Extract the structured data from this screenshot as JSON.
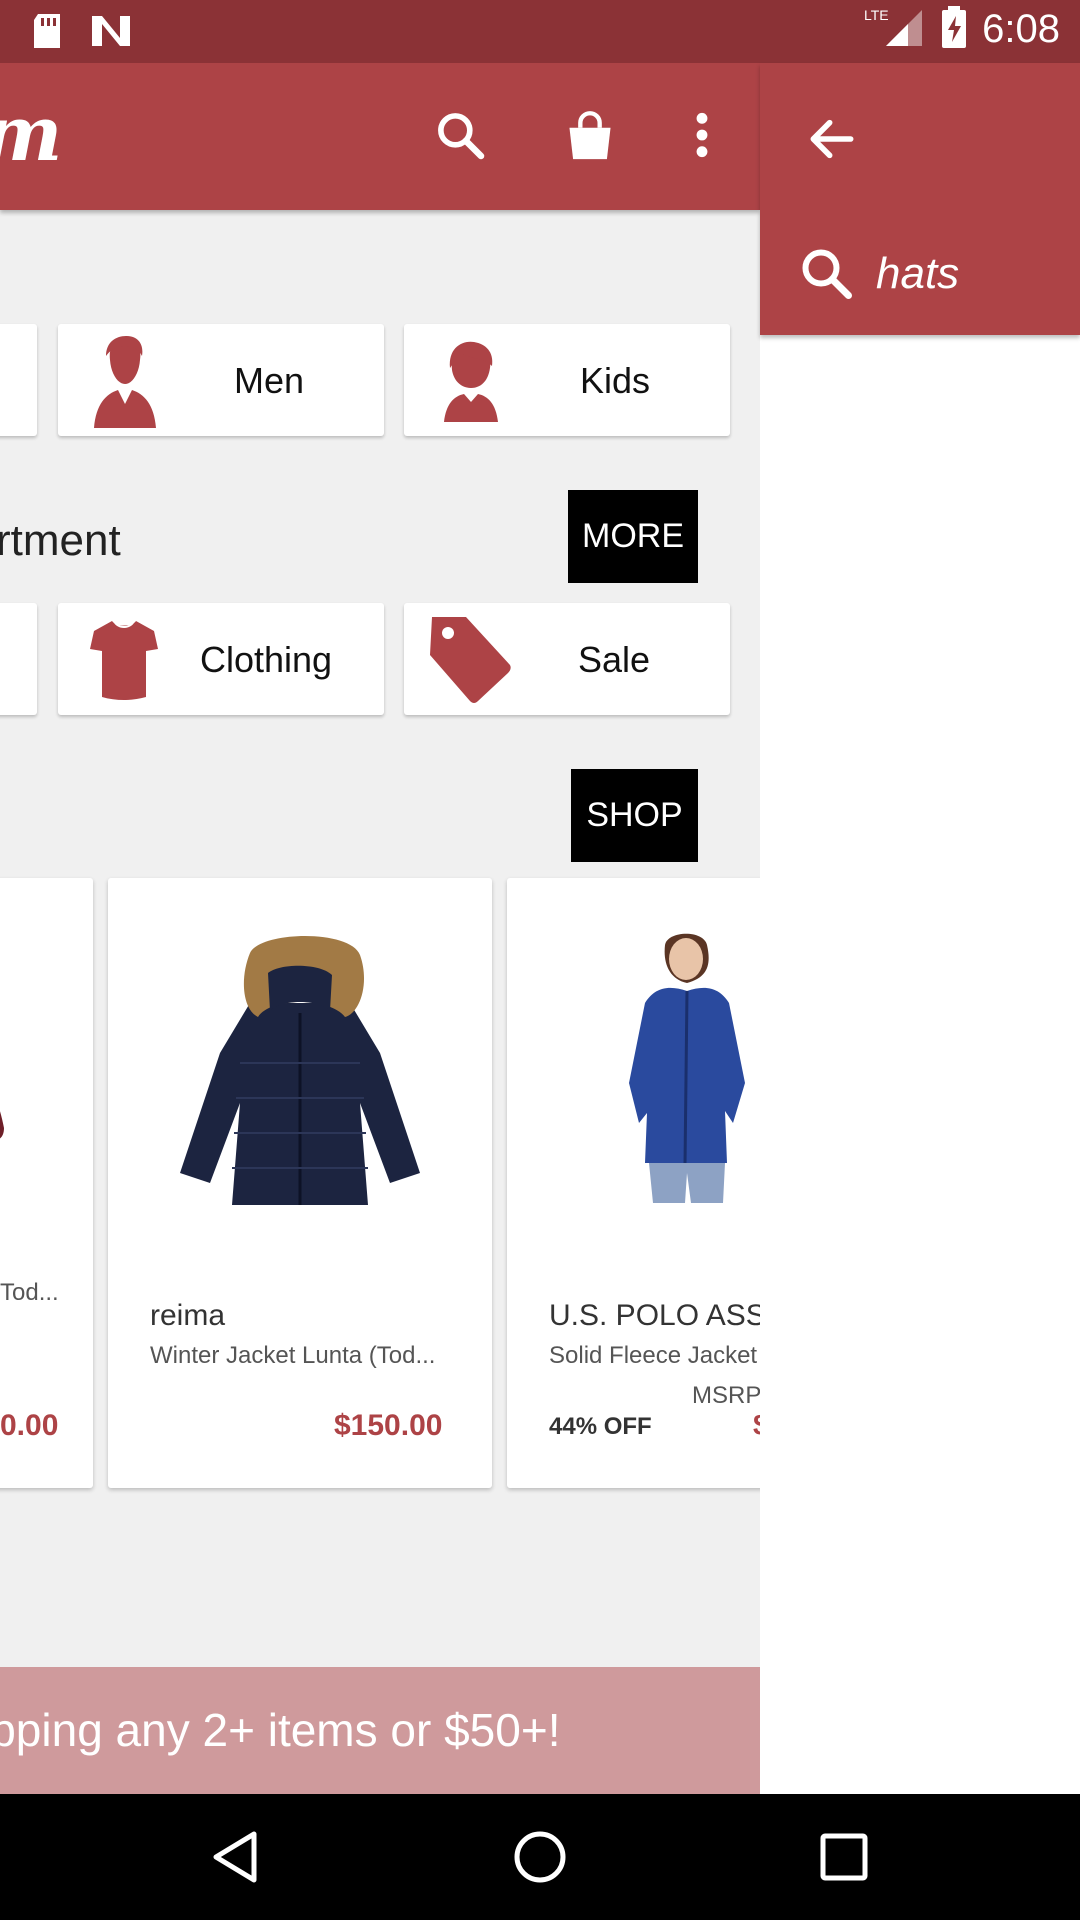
{
  "status_bar": {
    "time": "6:08",
    "network": "LTE",
    "icons": [
      "sd-card-icon",
      "n-notification-icon",
      "lte-signal-icon",
      "battery-charging-icon"
    ]
  },
  "toolbar": {
    "logo_text": "m",
    "icons": [
      "search-icon",
      "shopping-bag-icon",
      "overflow-menu-icon"
    ],
    "background": "#ad4346"
  },
  "categories_row1": [
    {
      "label": "Men",
      "icon": "man-icon"
    },
    {
      "label": "Kids",
      "icon": "kid-icon"
    }
  ],
  "department": {
    "title_partial": "rtment",
    "more_label": "MORE"
  },
  "categories_row2": [
    {
      "label": "Clothing",
      "icon": "shirt-icon"
    },
    {
      "label": "Sale",
      "icon": "tag-icon"
    }
  ],
  "shop_label": "SHOP",
  "products": [
    {
      "name_partial": "Tod...",
      "price_partial": "0.00"
    },
    {
      "brand": "reima",
      "name": "Winter Jacket Lunta (Tod...",
      "price": "$150.00"
    },
    {
      "brand": "U.S. POLO ASS",
      "name": "Solid Fleece Jacket",
      "msrp_label": "MSRP",
      "discount": "44% OFF",
      "price_partial": "$"
    }
  ],
  "banner": {
    "text": "ipping any 2+ items or $50+!",
    "color": "#cf9a9c"
  },
  "drawer": {
    "query": "hats",
    "back_icon": "back-arrow-icon",
    "search_icon": "search-icon"
  },
  "nav_bar": [
    "back-triangle-icon",
    "home-circle-icon",
    "recents-square-icon"
  ]
}
